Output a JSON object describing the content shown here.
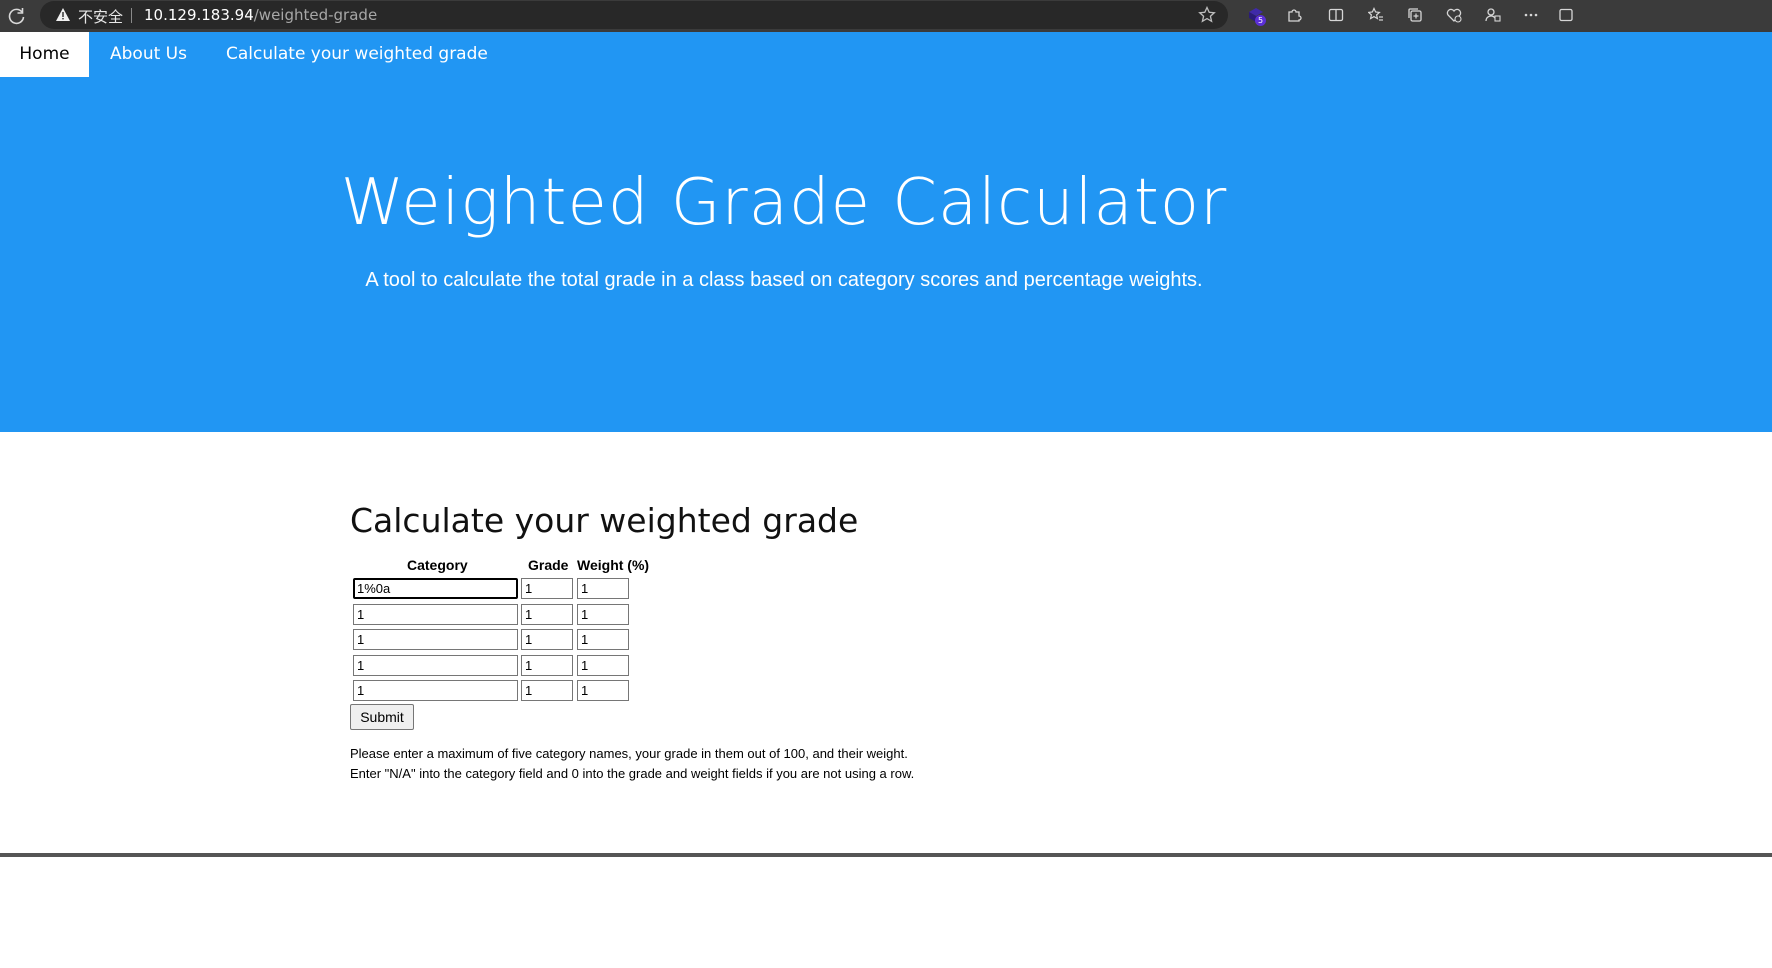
{
  "browser": {
    "insecure_label": "不安全",
    "url_host": "10.129.183.94",
    "url_path": "/weighted-grade",
    "extensions_badge": "5"
  },
  "nav": {
    "items": [
      {
        "label": "Home",
        "active": true
      },
      {
        "label": "About Us",
        "active": false
      },
      {
        "label": "Calculate your weighted grade",
        "active": false
      }
    ]
  },
  "hero": {
    "title": "Weighted Grade Calculator",
    "subtitle": "A tool to calculate the total grade in a class based on category scores and percentage weights."
  },
  "form": {
    "title": "Calculate your weighted grade",
    "headers": {
      "category": "Category",
      "grade": "Grade",
      "weight": "Weight (%)"
    },
    "rows": [
      {
        "category": "1%0a",
        "grade": "1",
        "weight": "1"
      },
      {
        "category": "1",
        "grade": "1",
        "weight": "1"
      },
      {
        "category": "1",
        "grade": "1",
        "weight": "1"
      },
      {
        "category": "1",
        "grade": "1",
        "weight": "1"
      },
      {
        "category": "1",
        "grade": "1",
        "weight": "1"
      }
    ],
    "submit_label": "Submit",
    "note_line1": "Please enter a maximum of five category names, your grade in them out of 100, and their weight.",
    "note_line2": "Enter \"N/A\" into the category field and 0 into the grade and weight fields if you are not using a row."
  },
  "colors": {
    "primary": "#2196f3",
    "chrome": "#3b3b3b"
  }
}
